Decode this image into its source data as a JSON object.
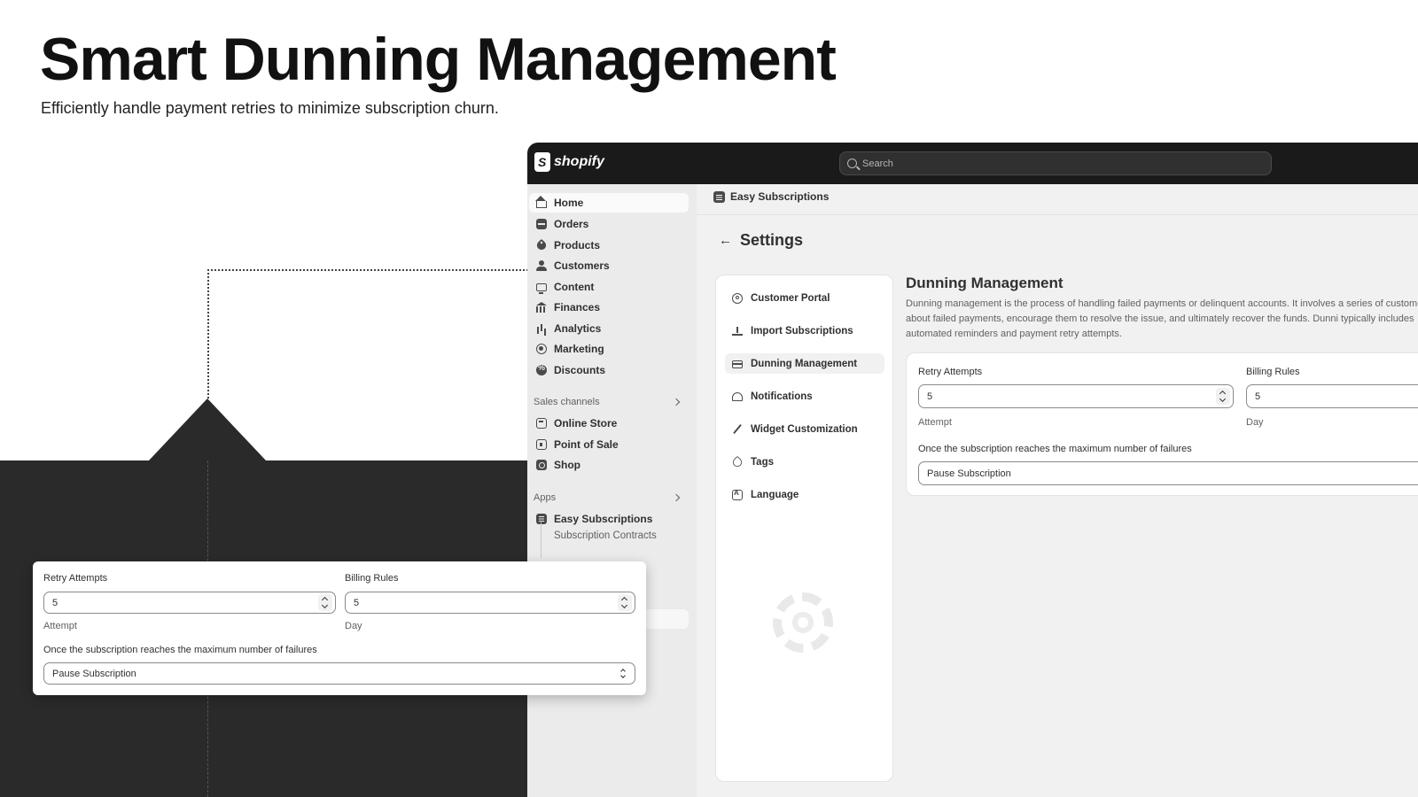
{
  "hero": {
    "title": "Smart Dunning Management",
    "subtitle": "Efficiently handle payment retries to minimize subscription churn."
  },
  "topbar": {
    "brand": "shopify",
    "search_placeholder": "Search"
  },
  "sidebar": {
    "items": [
      {
        "label": "Home",
        "icon": "home-icon"
      },
      {
        "label": "Orders",
        "icon": "inbox-icon"
      },
      {
        "label": "Products",
        "icon": "tag-icon"
      },
      {
        "label": "Customers",
        "icon": "person-icon"
      },
      {
        "label": "Content",
        "icon": "monitor-icon"
      },
      {
        "label": "Finances",
        "icon": "bank-icon"
      },
      {
        "label": "Analytics",
        "icon": "bar-chart-icon"
      },
      {
        "label": "Marketing",
        "icon": "target-icon"
      },
      {
        "label": "Discounts",
        "icon": "discount-icon"
      }
    ],
    "sales_channels_heading": "Sales channels",
    "sales_channels": [
      {
        "label": "Online Store",
        "icon": "store-icon"
      },
      {
        "label": "Point of Sale",
        "icon": "pos-icon"
      },
      {
        "label": "Shop",
        "icon": "shop-icon"
      }
    ],
    "apps_heading": "Apps",
    "apps": [
      {
        "label": "Easy Subscriptions",
        "icon": "app-icon"
      }
    ],
    "app_subitems": [
      "Subscription Contracts"
    ]
  },
  "main": {
    "breadcrumb": "Easy Subscriptions",
    "settings_title": "Settings",
    "settings_nav": [
      {
        "label": "Customer Portal",
        "icon": "gear-icon"
      },
      {
        "label": "Import Subscriptions",
        "icon": "upload-icon"
      },
      {
        "label": "Dunning Management",
        "icon": "credit-card-icon"
      },
      {
        "label": "Notifications",
        "icon": "bell-icon"
      },
      {
        "label": "Widget Customization",
        "icon": "pen-icon"
      },
      {
        "label": "Tags",
        "icon": "tag-icon"
      },
      {
        "label": "Language",
        "icon": "language-icon"
      }
    ],
    "dunning_title": "Dunning Management",
    "dunning_description": "Dunning management is the process of handling failed payments or delinquent accounts. It involves a series of customers about failed payments, encourage them to resolve the issue, and ultimately recover the funds. Dunni typically includes automated reminders and payment retry attempts.",
    "form": {
      "retry_label": "Retry Attempts",
      "retry_value": "5",
      "retry_help": "Attempt",
      "billing_label": "Billing Rules",
      "billing_value": "5",
      "billing_help": "Day",
      "failure_label": "Once the subscription reaches the maximum number of failures",
      "failure_value": "Pause Subscription"
    }
  },
  "callout": {
    "retry_label": "Retry Attempts",
    "retry_value": "5",
    "retry_help": "Attempt",
    "billing_label": "Billing Rules",
    "billing_value": "5",
    "billing_help": "Day",
    "failure_label": "Once the subscription reaches the maximum number of failures",
    "failure_value": "Pause Subscription"
  },
  "colors": {
    "topbar": "#1a1a1a",
    "dark_block": "#2b2a2b",
    "admin_bg": "#f1f1f1"
  }
}
